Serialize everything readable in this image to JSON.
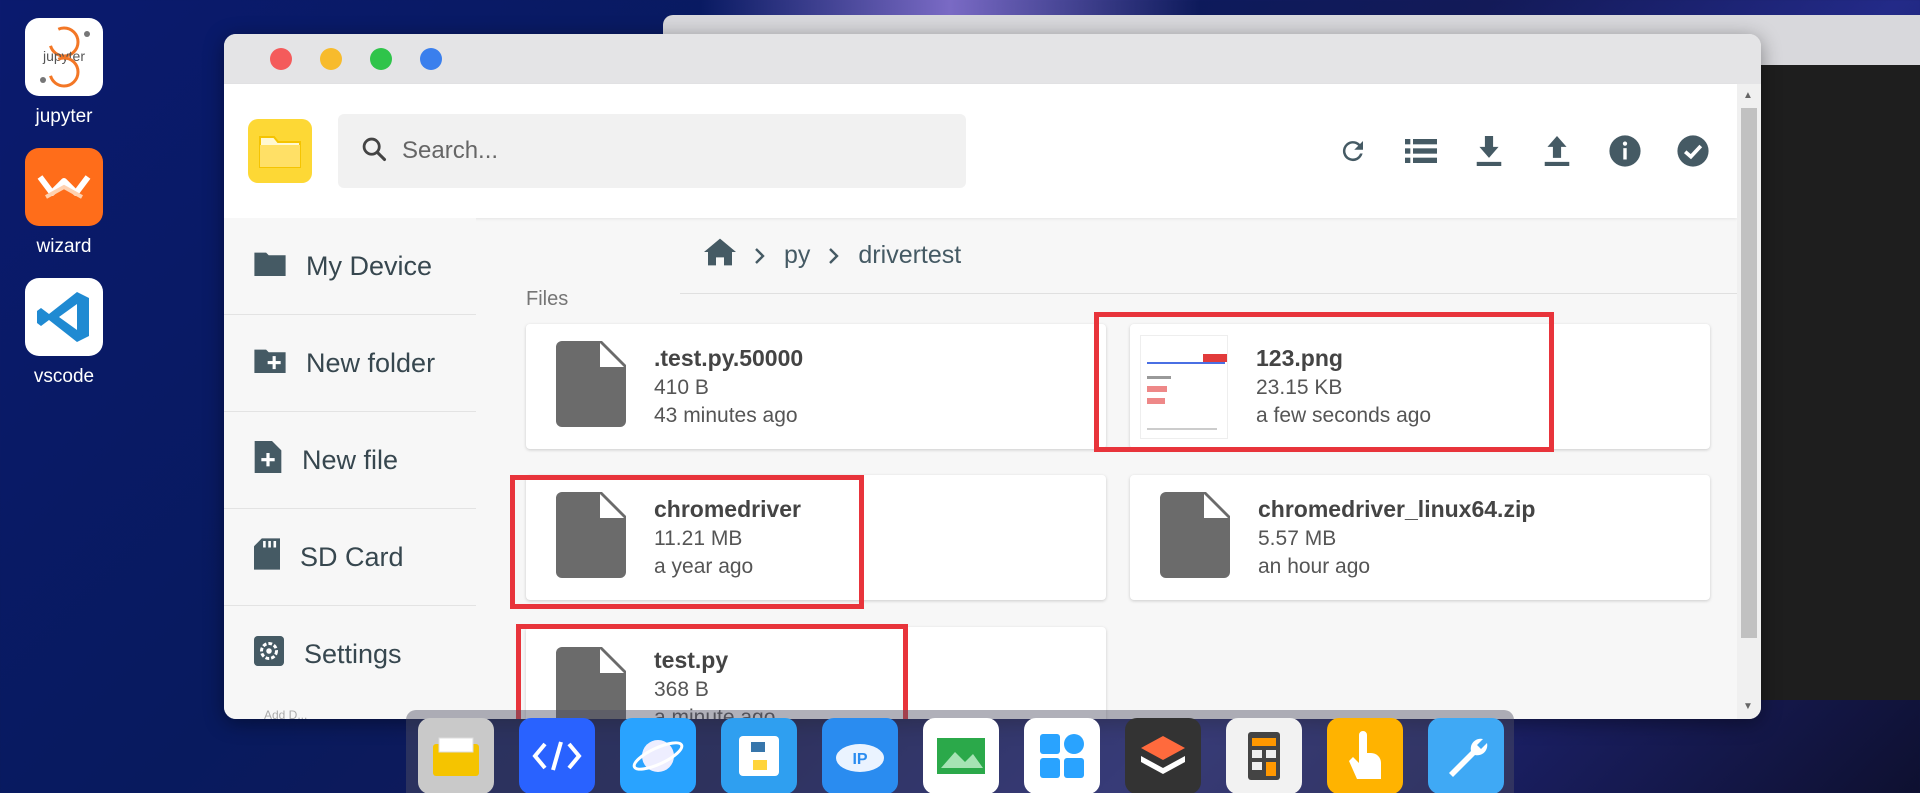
{
  "desktop": {
    "icons": [
      {
        "label": "jupyter",
        "glyph_text": "jupyter"
      },
      {
        "label": "wizard"
      },
      {
        "label": "vscode"
      }
    ]
  },
  "window": {
    "traffic_colors": [
      "#f45b5b",
      "#f7bb2c",
      "#2fc44a",
      "#3a7fed"
    ]
  },
  "header": {
    "search_placeholder": "Search...",
    "tools": [
      "refresh-icon",
      "list-view-icon",
      "download-icon",
      "upload-icon",
      "info-icon",
      "select-all-icon"
    ]
  },
  "sidebar": {
    "items": [
      {
        "label": "My Device",
        "icon": "folder-icon"
      },
      {
        "label": "New folder",
        "icon": "new-folder-icon"
      },
      {
        "label": "New file",
        "icon": "new-file-icon"
      },
      {
        "label": "SD Card",
        "icon": "sd-card-icon"
      },
      {
        "label": "Settings",
        "icon": "settings-icon"
      }
    ],
    "footer": "Add D..."
  },
  "breadcrumb": [
    "py",
    "drivertest"
  ],
  "files_label": "Files",
  "files": [
    {
      "name": ".test.py.50000",
      "size": "410 B",
      "modified": "43 minutes ago"
    },
    {
      "name": "123.png",
      "size": "23.15 KB",
      "modified": "a few seconds ago"
    },
    {
      "name": "chromedriver",
      "size": "11.21 MB",
      "modified": "a year ago"
    },
    {
      "name": "chromedriver_linux64.zip",
      "size": "5.57 MB",
      "modified": "an hour ago"
    },
    {
      "name": "test.py",
      "size": "368 B",
      "modified": "a minute ago"
    }
  ],
  "colors": {
    "accent_yellow": "#fdd835",
    "highlight_red": "#e8343b",
    "icon_gray": "#455a64"
  },
  "dock": [
    "files",
    "code-editor",
    "browser",
    "python",
    "ip",
    "gallery",
    "apps",
    "layers",
    "calculator",
    "touch",
    "tools"
  ]
}
